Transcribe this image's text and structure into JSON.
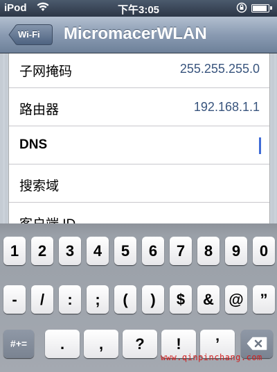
{
  "status_bar": {
    "carrier": "iPod",
    "time": "下午3:05",
    "battery_level": 0.85,
    "icons": [
      "wifi-icon",
      "rotation-lock-icon",
      "battery-icon"
    ]
  },
  "nav_bar": {
    "back_label": "Wi-Fi",
    "title": "MicromacerWLAN"
  },
  "settings": {
    "rows": [
      {
        "label": "子网掩码",
        "value": "255.255.255.0"
      },
      {
        "label": "路由器",
        "value": "192.168.1.1"
      },
      {
        "label": "DNS",
        "value": ""
      },
      {
        "label": "搜索域",
        "value": ""
      },
      {
        "label": "客户端 ID",
        "value": ""
      }
    ]
  },
  "keyboard": {
    "row1": [
      "1",
      "2",
      "3",
      "4",
      "5",
      "6",
      "7",
      "8",
      "9",
      "0"
    ],
    "row2": [
      "-",
      "/",
      ":",
      ";",
      "(",
      ")",
      "$",
      "&",
      "@",
      "”"
    ],
    "row3": [
      "#+=",
      ".",
      ",",
      "?",
      "!",
      "’"
    ],
    "delete_icon": "delete-icon"
  },
  "watermark": "www.qinpinchang.com",
  "colors": {
    "value_text": "#38547d",
    "cursor": "#3f6bd6",
    "nav_bar": "#8a9bb2",
    "watermark": "#d02020"
  }
}
